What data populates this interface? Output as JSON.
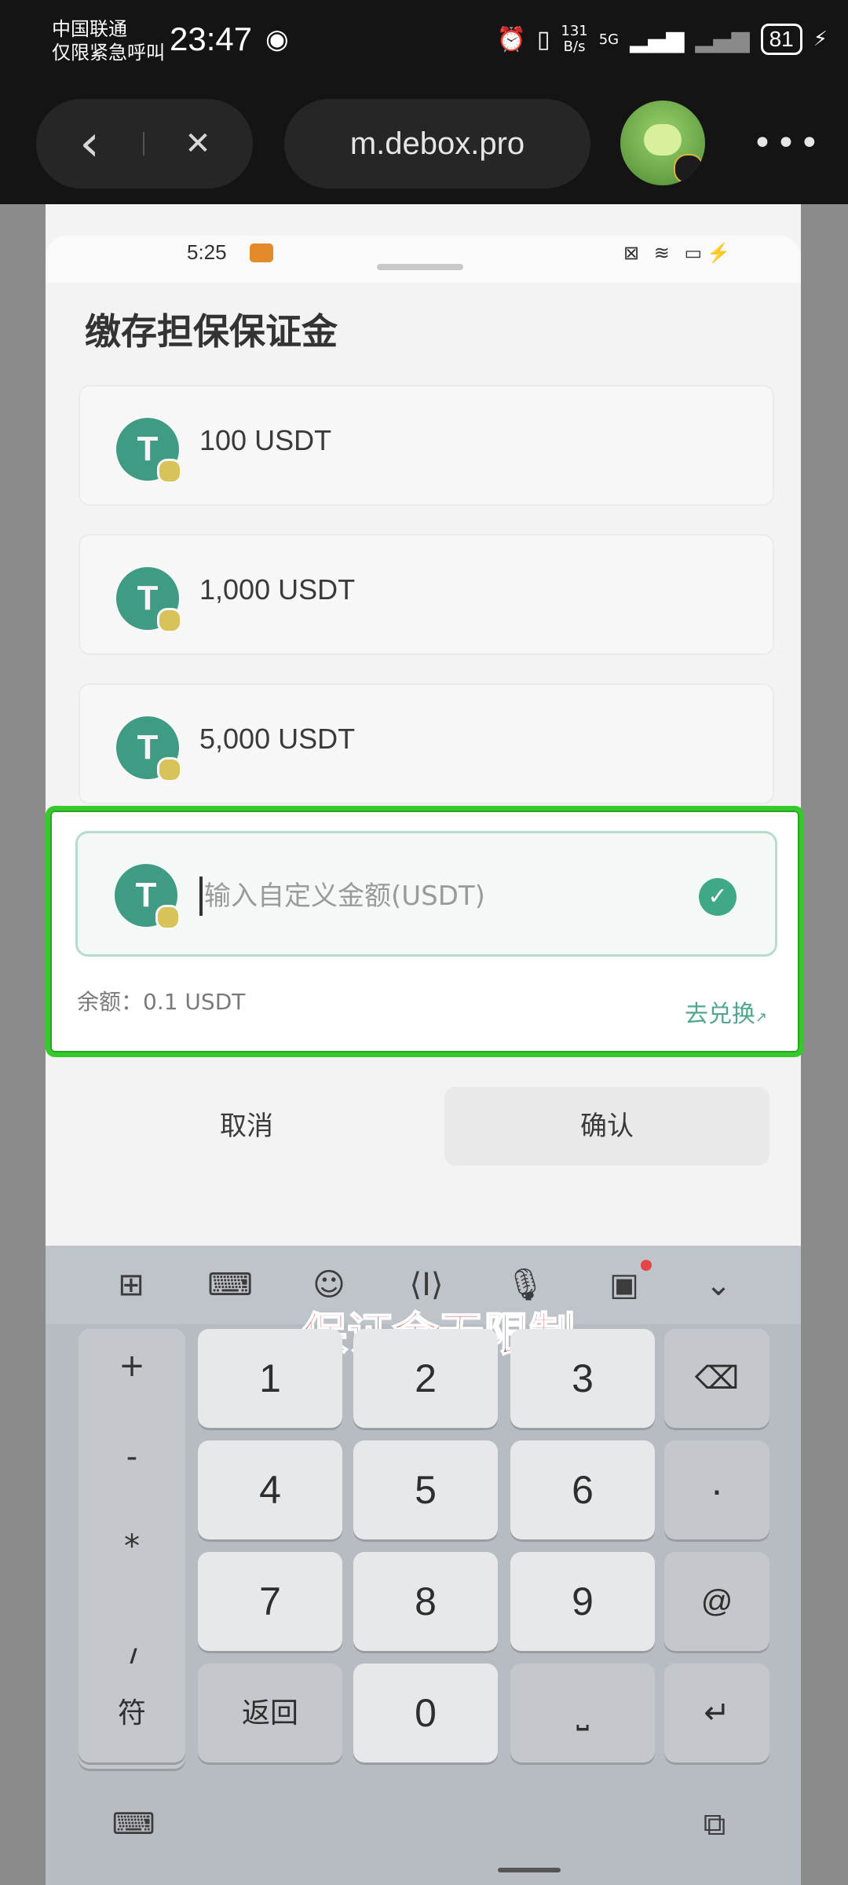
{
  "status_bar": {
    "carrier_line1": "中国联通",
    "carrier_line2": "仅限紧急呼叫",
    "time": "23:47",
    "speed_value": "131",
    "speed_unit": "B/s",
    "network": "5G",
    "battery": "81"
  },
  "browser": {
    "url": "m.debox.pro",
    "back_icon": "‹",
    "close_icon": "✕",
    "more_icon": "•••"
  },
  "inner_status": {
    "time": "5:25"
  },
  "sheet": {
    "title": "缴存担保保证金",
    "options": [
      {
        "label": "100 USDT"
      },
      {
        "label": "1,000 USDT"
      },
      {
        "label": "5,000 USDT"
      }
    ],
    "custom": {
      "placeholder": "输入自定义金额(USDT)",
      "balance": "余额：0.1 USDT",
      "swap_link": "去兑换"
    },
    "cancel": "取消",
    "confirm": "确认"
  },
  "coin_symbol": "T",
  "overlay_caption": "保证金无限制",
  "keyboard": {
    "toolbar_icons": [
      "grid-icon",
      "keyboard-icon",
      "emoji-icon",
      "cursor-icon",
      "mic-icon",
      "clipboard-icon",
      "collapse-icon"
    ],
    "side_keys": [
      "+",
      "-",
      "*",
      "/"
    ],
    "row1": [
      "1",
      "2",
      "3"
    ],
    "row2": [
      "4",
      "5",
      "6"
    ],
    "row3": [
      "7",
      "8",
      "9"
    ],
    "bottom": {
      "symbols": "符",
      "back": "返回",
      "zero": "0"
    },
    "right_keys": {
      "dot": "·",
      "at": "@"
    }
  },
  "colors": {
    "accent_green": "#3fa987",
    "highlight_border": "#35c92c",
    "overlay_red": "#c61f2a"
  }
}
